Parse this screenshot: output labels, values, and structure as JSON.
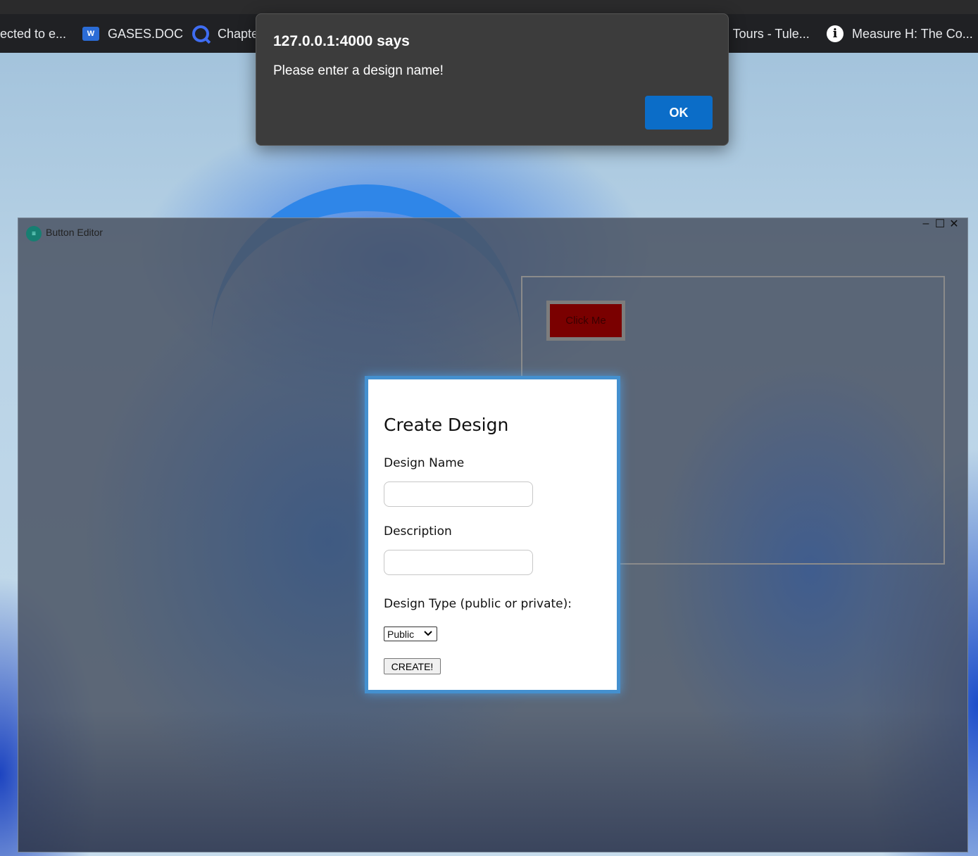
{
  "bookmarks": {
    "items": [
      {
        "label": "ected to e...",
        "icon": "none"
      },
      {
        "label": "GASES.DOC",
        "icon": "word-icon"
      },
      {
        "label": "Chapte",
        "icon": "q-icon"
      },
      {
        "label": "l Tours - Tule...",
        "icon": "none"
      },
      {
        "label": "Measure H: The Co...",
        "icon": "info-icon"
      }
    ]
  },
  "alert": {
    "title": "127.0.0.1:4000 says",
    "message": "Please enter a design name!",
    "ok_label": "OK"
  },
  "app": {
    "title": "Button Editor",
    "logo_text": "≡",
    "controls": {
      "minimize": "–",
      "maximize": "☐",
      "close": "✕"
    },
    "preview_button_label": "Click Me"
  },
  "modal": {
    "title": "Create Design",
    "name_label": "Design Name",
    "name_value": "",
    "description_label": "Description",
    "description_value": "",
    "type_label": "Design Type (public or private):",
    "type_selected": "Public",
    "create_label": "CREATE!"
  },
  "colors": {
    "alert_ok": "#0b6dc8",
    "modal_border": "#4490cf",
    "preview_button_bg": "#7a0000"
  }
}
